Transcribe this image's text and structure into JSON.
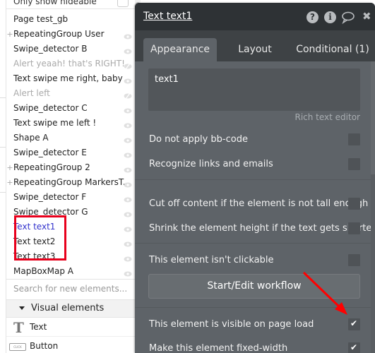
{
  "tree_panel": {
    "filter_label": "Only show hideable",
    "items": [
      {
        "label": "Page test_gb",
        "expandable": false,
        "state": "normal",
        "eye": "none"
      },
      {
        "label": "RepeatingGroup User",
        "expandable": true,
        "state": "normal",
        "eye": "visible"
      },
      {
        "label": "Swipe_detector B",
        "expandable": false,
        "state": "normal",
        "eye": "visible"
      },
      {
        "label": "Alert yeaah! that's RIGHT!",
        "expandable": false,
        "state": "hidden",
        "eye": "hidden"
      },
      {
        "label": "Text swipe me right, baby",
        "expandable": false,
        "state": "normal",
        "eye": "visible"
      },
      {
        "label": "Alert left",
        "expandable": false,
        "state": "hidden",
        "eye": "hidden"
      },
      {
        "label": "Swipe_detector C",
        "expandable": false,
        "state": "normal",
        "eye": "visible"
      },
      {
        "label": "Text swipe me left !",
        "expandable": false,
        "state": "normal",
        "eye": "visible"
      },
      {
        "label": "Shape A",
        "expandable": false,
        "state": "normal",
        "eye": "visible"
      },
      {
        "label": "Swipe_detector E",
        "expandable": false,
        "state": "normal",
        "eye": "visible"
      },
      {
        "label": "RepeatingGroup 2",
        "expandable": true,
        "state": "normal",
        "eye": "visible"
      },
      {
        "label": "RepeatingGroup MarkersT...",
        "expandable": true,
        "state": "normal",
        "eye": "visible"
      },
      {
        "label": "Swipe_detector F",
        "expandable": false,
        "state": "normal",
        "eye": "visible"
      },
      {
        "label": "Swipe_detector G",
        "expandable": false,
        "state": "normal",
        "eye": "visible"
      },
      {
        "label": "Text text1",
        "expandable": false,
        "state": "selected",
        "eye": "visible"
      },
      {
        "label": "Text text2",
        "expandable": false,
        "state": "normal",
        "eye": "visible"
      },
      {
        "label": "Text text3",
        "expandable": false,
        "state": "normal",
        "eye": "visible"
      },
      {
        "label": "MapBoxMap A",
        "expandable": false,
        "state": "normal",
        "eye": "visible"
      }
    ],
    "search_placeholder": "Search for new elements...",
    "section_label": "Visual elements",
    "palette": [
      {
        "label": "Text",
        "icon": "text-t-icon"
      },
      {
        "label": "Button",
        "icon": "button-click-icon",
        "icon_text": "CLICK"
      }
    ]
  },
  "editor": {
    "title": "Text text1",
    "header_icons": [
      {
        "name": "help-icon",
        "glyph": "?"
      },
      {
        "name": "info-icon",
        "glyph": "i"
      },
      {
        "name": "comment-icon"
      },
      {
        "name": "close-icon",
        "glyph": "✖"
      }
    ],
    "tabs": [
      {
        "label": "Appearance",
        "active": true
      },
      {
        "label": "Layout",
        "active": false
      },
      {
        "label": "Conditional (1)",
        "active": false
      }
    ],
    "text_value": "text1",
    "rich_text_link": "Rich text editor",
    "properties": [
      {
        "label": "Do not apply bb-code",
        "checked": false
      },
      {
        "label": "Recognize links and emails",
        "checked": false
      },
      {
        "label": "Cut off content if the element is not tall enough",
        "checked": false
      },
      {
        "label": "Shrink the element height if the text gets shorter",
        "checked": false
      },
      {
        "label": "This element isn't clickable",
        "checked": false
      },
      {
        "label": "This element is visible on page load",
        "checked": true
      },
      {
        "label": "Make this element fixed-width",
        "checked": true
      }
    ],
    "workflow_button": "Start/Edit workflow",
    "check_glyph": "✔"
  },
  "annotations": {
    "highlight_color": "#e8001c",
    "arrow_color": "#ff0000"
  }
}
